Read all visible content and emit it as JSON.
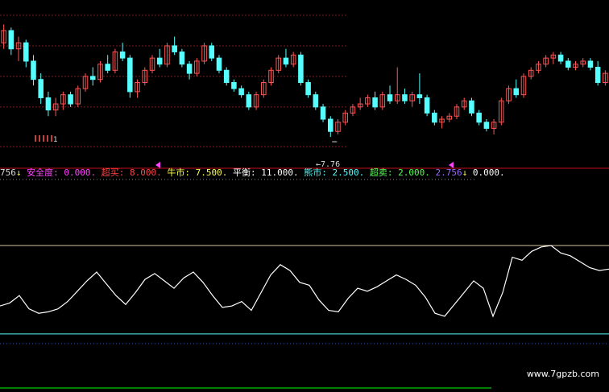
{
  "colors": {
    "background": "#000000",
    "up": "#ff5555",
    "down": "#55ffff",
    "grid_red": "#7a1a1a",
    "line_white": "#ffffff",
    "cyan_line": "#55ffff",
    "green_line": "#00ff00",
    "magenta": "#ff44ff"
  },
  "legend": {
    "lead_value": "756",
    "lead_arrow": "↓",
    "safety_label": "安全度",
    "safety_value": "0.000",
    "oversold_label": "超买",
    "oversold_value": "8.000",
    "bull_label": "牛市",
    "bull_value": "7.500",
    "balance_label": "平衡",
    "balance_value": "11.000",
    "bear_label": "熊市",
    "bear_value": "2.500",
    "overbought_label": "超卖",
    "overbought_value": "2.000",
    "current_value": "2.756",
    "current_arrow": "↓",
    "trail_value": "0.000"
  },
  "annotation": {
    "low_label": "←7.76",
    "left_marker": "1"
  },
  "watermark": "www.7gpzb.com",
  "chart_data": [
    {
      "type": "candlestick",
      "series": [
        {
          "values": [
            [
              9.3,
              9.6,
              9.2,
              9.5
            ],
            [
              9.5,
              9.55,
              9.1,
              9.2
            ],
            [
              9.2,
              9.4,
              9.0,
              9.3
            ],
            [
              9.3,
              9.35,
              8.9,
              9.0
            ],
            [
              9.0,
              9.1,
              8.6,
              8.7
            ],
            [
              8.7,
              8.8,
              8.3,
              8.4
            ],
            [
              8.4,
              8.5,
              8.1,
              8.2
            ],
            [
              8.2,
              8.4,
              8.1,
              8.3
            ],
            [
              8.3,
              8.5,
              8.2,
              8.45
            ],
            [
              8.45,
              8.5,
              8.25,
              8.3
            ],
            [
              8.3,
              8.6,
              8.25,
              8.55
            ],
            [
              8.55,
              8.8,
              8.5,
              8.75
            ],
            [
              8.75,
              8.9,
              8.6,
              8.7
            ],
            [
              8.7,
              9.0,
              8.65,
              8.95
            ],
            [
              8.95,
              9.1,
              8.8,
              8.85
            ],
            [
              8.85,
              9.2,
              8.8,
              9.15
            ],
            [
              9.15,
              9.3,
              9.0,
              9.05
            ],
            [
              9.05,
              9.1,
              8.4,
              8.5
            ],
            [
              8.5,
              8.7,
              8.4,
              8.65
            ],
            [
              8.65,
              8.9,
              8.6,
              8.85
            ],
            [
              8.85,
              9.1,
              8.8,
              9.05
            ],
            [
              9.05,
              9.2,
              8.9,
              8.95
            ],
            [
              8.95,
              9.3,
              8.9,
              9.25
            ],
            [
              9.25,
              9.4,
              9.1,
              9.15
            ],
            [
              9.15,
              9.2,
              8.9,
              8.95
            ],
            [
              8.95,
              9.0,
              8.7,
              8.8
            ],
            [
              8.8,
              9.05,
              8.75,
              9.0
            ],
            [
              9.0,
              9.3,
              8.95,
              9.25
            ],
            [
              9.25,
              9.3,
              9.0,
              9.05
            ],
            [
              9.05,
              9.1,
              8.8,
              8.85
            ],
            [
              8.85,
              8.9,
              8.6,
              8.65
            ],
            [
              8.65,
              8.7,
              8.5,
              8.55
            ],
            [
              8.55,
              8.6,
              8.4,
              8.45
            ],
            [
              8.45,
              8.5,
              8.2,
              8.25
            ],
            [
              8.25,
              8.5,
              8.2,
              8.45
            ],
            [
              8.45,
              8.7,
              8.4,
              8.65
            ],
            [
              8.65,
              8.9,
              8.6,
              8.85
            ],
            [
              8.85,
              9.1,
              8.8,
              9.05
            ],
            [
              9.05,
              9.2,
              8.9,
              8.95
            ],
            [
              8.95,
              9.15,
              8.9,
              9.1
            ],
            [
              9.1,
              9.15,
              8.6,
              8.65
            ],
            [
              8.65,
              8.7,
              8.4,
              8.45
            ],
            [
              8.45,
              8.5,
              8.2,
              8.25
            ],
            [
              8.25,
              8.3,
              8.0,
              8.05
            ],
            [
              8.05,
              8.1,
              7.76,
              7.85
            ],
            [
              7.85,
              8.05,
              7.8,
              8.0
            ],
            [
              8.0,
              8.2,
              7.95,
              8.15
            ],
            [
              8.15,
              8.3,
              8.1,
              8.25
            ],
            [
              8.25,
              8.4,
              8.2,
              8.3
            ],
            [
              8.3,
              8.45,
              8.25,
              8.4
            ],
            [
              8.4,
              8.5,
              8.2,
              8.25
            ],
            [
              8.25,
              8.5,
              8.2,
              8.45
            ],
            [
              8.45,
              8.6,
              8.3,
              8.35
            ],
            [
              8.35,
              8.9,
              8.3,
              8.45
            ],
            [
              8.45,
              8.55,
              8.3,
              8.35
            ],
            [
              8.35,
              8.5,
              8.25,
              8.45
            ],
            [
              8.45,
              8.8,
              8.3,
              8.4
            ],
            [
              8.4,
              8.45,
              8.1,
              8.15
            ],
            [
              8.15,
              8.2,
              7.95,
              8.0
            ],
            [
              8.0,
              8.1,
              7.9,
              8.05
            ],
            [
              8.05,
              8.15,
              8.0,
              8.1
            ],
            [
              8.1,
              8.3,
              8.05,
              8.25
            ],
            [
              8.25,
              8.4,
              8.2,
              8.35
            ],
            [
              8.35,
              8.4,
              8.1,
              8.15
            ],
            [
              8.15,
              8.2,
              7.95,
              8.0
            ],
            [
              8.0,
              8.05,
              7.85,
              7.9
            ],
            [
              7.9,
              8.05,
              7.8,
              8.0
            ],
            [
              8.0,
              8.4,
              7.95,
              8.35
            ],
            [
              8.35,
              8.6,
              8.3,
              8.55
            ],
            [
              8.55,
              8.7,
              8.4,
              8.45
            ],
            [
              8.45,
              8.8,
              8.4,
              8.75
            ],
            [
              8.75,
              8.9,
              8.7,
              8.85
            ],
            [
              8.85,
              9.0,
              8.8,
              8.95
            ],
            [
              8.95,
              9.1,
              8.9,
              9.05
            ],
            [
              9.05,
              9.15,
              8.95,
              9.1
            ],
            [
              9.1,
              9.15,
              8.95,
              9.0
            ],
            [
              9.0,
              9.05,
              8.85,
              8.9
            ],
            [
              8.9,
              9.0,
              8.85,
              8.95
            ],
            [
              8.95,
              9.05,
              8.9,
              9.0
            ],
            [
              9.0,
              9.05,
              8.85,
              8.9
            ],
            [
              8.9,
              9.0,
              8.6,
              8.65
            ],
            [
              8.65,
              8.85,
              8.6,
              8.8
            ]
          ]
        }
      ],
      "ylim": [
        7.3,
        10.0
      ],
      "low_marker_value": 7.76,
      "grid_levels": [
        9.75,
        9.25,
        8.75,
        8.25,
        7.6
      ]
    },
    {
      "type": "line",
      "series": [
        {
          "values": [
            3.9,
            4.1,
            4.6,
            3.7,
            3.4,
            3.5,
            3.7,
            4.2,
            4.9,
            5.6,
            6.2,
            5.4,
            4.6,
            4.0,
            4.8,
            5.7,
            6.1,
            5.6,
            5.1,
            5.8,
            6.2,
            5.5,
            4.6,
            3.8,
            3.9,
            4.2,
            3.6,
            4.8,
            6.0,
            6.7,
            6.3,
            5.5,
            5.3,
            4.3,
            3.6,
            3.5,
            4.4,
            5.1,
            4.9,
            5.2,
            5.6,
            6.0,
            5.7,
            5.3,
            4.5,
            3.4,
            3.2,
            4.0,
            4.8,
            5.6,
            5.1,
            3.2,
            4.8,
            7.2,
            7.0,
            7.6,
            7.9,
            8.0,
            7.5,
            7.3,
            6.9,
            6.5,
            6.3,
            6.4
          ]
        }
      ],
      "ylim": [
        1.5,
        8.0
      ],
      "reference_lines": [
        8.0,
        2.0
      ]
    }
  ]
}
